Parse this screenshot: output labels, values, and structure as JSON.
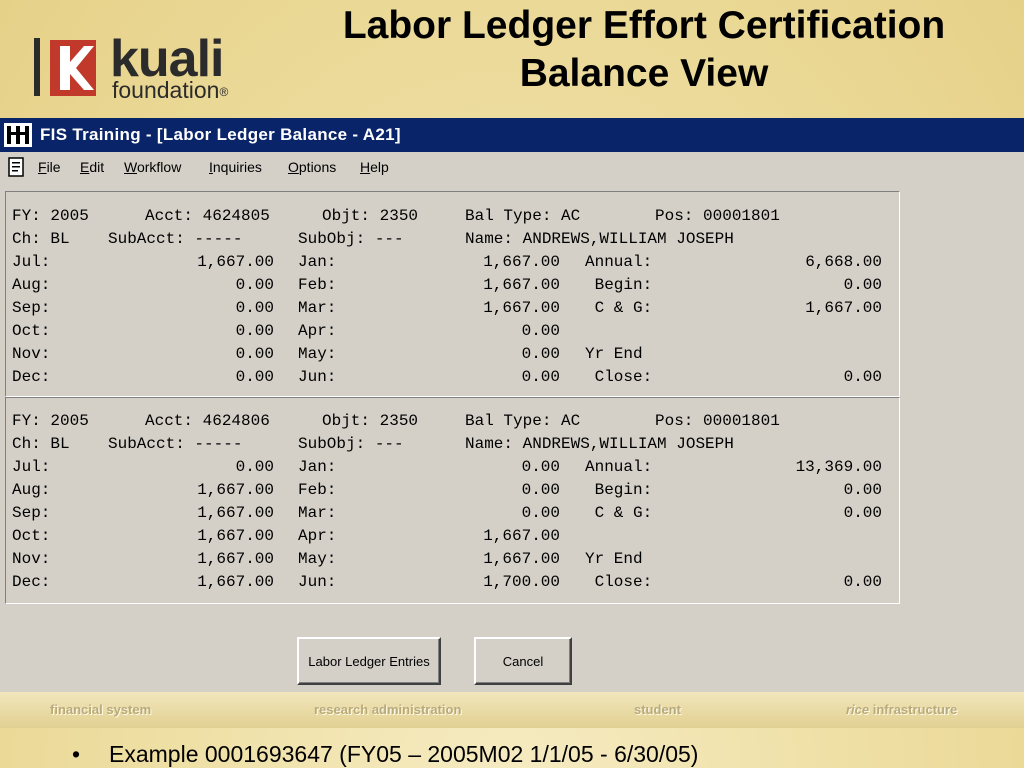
{
  "logo": {
    "brand": "kuali",
    "sub": "foundation",
    "mark": "®",
    "icon": "kuali-k-logo"
  },
  "slide_title": "Labor Ledger Effort Certification Balance View",
  "window": {
    "icon": "app-trident-icon",
    "title": "FIS Training - [Labor Ledger Balance - A21]",
    "menu": [
      {
        "acc": "F",
        "rest": "ile"
      },
      {
        "acc": "E",
        "rest": "dit"
      },
      {
        "acc": "W",
        "rest": "orkflow"
      },
      {
        "acc": "I",
        "rest": "nquiries"
      },
      {
        "acc": "O",
        "rest": "ptions"
      },
      {
        "acc": "H",
        "rest": "elp"
      }
    ],
    "menu_doc_icon": "document-icon"
  },
  "records": [
    {
      "fy": "FY: 2005",
      "acct": "Acct: 4624805",
      "objt": "Objt: 2350",
      "bal_type": "Bal Type: AC",
      "pos": "Pos: 00001801",
      "ch": "Ch: BL",
      "subacct": "SubAcct: -----",
      "subobj": "SubObj: ---",
      "name": "Name: ANDREWS,WILLIAM JOSEPH",
      "rows": [
        {
          "m1": "Jul:",
          "v1": "1,667.00",
          "m2": "Jan:",
          "v2": "1,667.00",
          "l3": "Annual:",
          "v3": "6,668.00"
        },
        {
          "m1": "Aug:",
          "v1": "0.00",
          "m2": "Feb:",
          "v2": "1,667.00",
          "l3": " Begin:",
          "v3": "0.00"
        },
        {
          "m1": "Sep:",
          "v1": "0.00",
          "m2": "Mar:",
          "v2": "1,667.00",
          "l3": " C & G:",
          "v3": "1,667.00"
        },
        {
          "m1": "Oct:",
          "v1": "0.00",
          "m2": "Apr:",
          "v2": "0.00",
          "l3": "",
          "v3": ""
        },
        {
          "m1": "Nov:",
          "v1": "0.00",
          "m2": "May:",
          "v2": "0.00",
          "l3": "Yr End",
          "v3": ""
        },
        {
          "m1": "Dec:",
          "v1": "0.00",
          "m2": "Jun:",
          "v2": "0.00",
          "l3": " Close:",
          "v3": "0.00"
        }
      ]
    },
    {
      "fy": "FY: 2005",
      "acct": "Acct: 4624806",
      "objt": "Objt: 2350",
      "bal_type": "Bal Type: AC",
      "pos": "Pos: 00001801",
      "ch": "Ch: BL",
      "subacct": "SubAcct: -----",
      "subobj": "SubObj: ---",
      "name": "Name: ANDREWS,WILLIAM JOSEPH",
      "rows": [
        {
          "m1": "Jul:",
          "v1": "0.00",
          "m2": "Jan:",
          "v2": "0.00",
          "l3": "Annual:",
          "v3": "13,369.00"
        },
        {
          "m1": "Aug:",
          "v1": "1,667.00",
          "m2": "Feb:",
          "v2": "0.00",
          "l3": " Begin:",
          "v3": "0.00"
        },
        {
          "m1": "Sep:",
          "v1": "1,667.00",
          "m2": "Mar:",
          "v2": "0.00",
          "l3": " C & G:",
          "v3": "0.00"
        },
        {
          "m1": "Oct:",
          "v1": "1,667.00",
          "m2": "Apr:",
          "v2": "1,667.00",
          "l3": "",
          "v3": ""
        },
        {
          "m1": "Nov:",
          "v1": "1,667.00",
          "m2": "May:",
          "v2": "1,667.00",
          "l3": "Yr End",
          "v3": ""
        },
        {
          "m1": "Dec:",
          "v1": "1,667.00",
          "m2": "Jun:",
          "v2": "1,700.00",
          "l3": " Close:",
          "v3": "0.00"
        }
      ]
    }
  ],
  "buttons": {
    "entries": "Labor Ledger Entries",
    "cancel": "Cancel"
  },
  "footer": {
    "tabs": [
      {
        "pre": "",
        "main": "financial system"
      },
      {
        "pre": "",
        "main": "research administration"
      },
      {
        "pre": "",
        "main": "student"
      },
      {
        "pre": "rice",
        "main": " infrastructure"
      }
    ]
  },
  "bullet": {
    "marker": "•",
    "text": "Example 0001693647 (FY05 – 2005M02 1/1/05 - 6/30/05)"
  }
}
